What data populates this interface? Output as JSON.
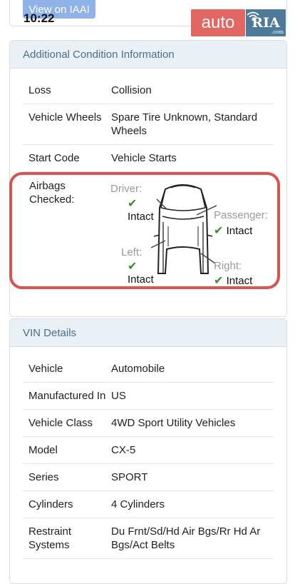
{
  "overlay": {
    "iaai_button": "View on IAAI",
    "time": "10:22",
    "logo_auto": "auto",
    "logo_ria": "RIA",
    "logo_ria_suffix": ".com"
  },
  "condition": {
    "header": "Additional Condition Information",
    "rows": [
      {
        "label": "Loss",
        "value": "Collision"
      },
      {
        "label": "Vehicle Wheels",
        "value": "Spare Tire Unknown, Standard Wheels"
      },
      {
        "label": "Start Code",
        "value": "Vehicle Starts"
      }
    ],
    "airbags": {
      "label": "Airbags Checked:",
      "driver": {
        "title": "Driver:",
        "status": "Intact"
      },
      "passenger": {
        "title": "Passenger:",
        "status": "Intact"
      },
      "left": {
        "title": "Left:",
        "status": "Intact"
      },
      "right": {
        "title": "Right:",
        "status": "Intact"
      },
      "check_icon": "✔",
      "highlight_color": "#d9534f"
    }
  },
  "vin": {
    "header": "VIN Details",
    "rows": [
      {
        "label": "Vehicle",
        "value": "Automobile"
      },
      {
        "label": "Manufactured In",
        "value": "US"
      },
      {
        "label": "Vehicle Class",
        "value": "4WD Sport Utility Vehicles"
      },
      {
        "label": "Model",
        "value": "CX-5"
      },
      {
        "label": "Series",
        "value": "SPORT"
      },
      {
        "label": "Cylinders",
        "value": "4 Cylinders"
      },
      {
        "label": "Restraint Systems",
        "value": "Du Frnt/Sd/Hd Air Bgs/Rr Hd Ar Bgs/Act Belts"
      }
    ]
  }
}
